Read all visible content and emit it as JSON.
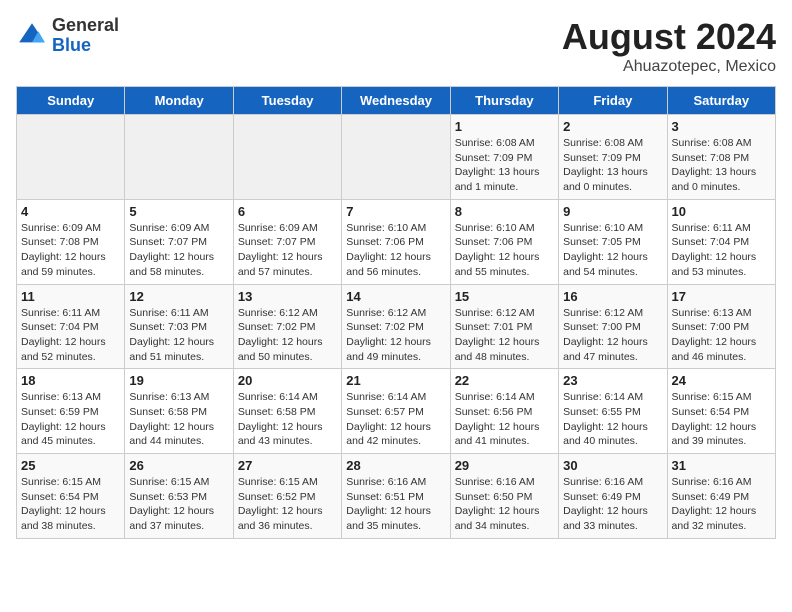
{
  "logo": {
    "general": "General",
    "blue": "Blue"
  },
  "title": "August 2024",
  "subtitle": "Ahuazotepec, Mexico",
  "days_of_week": [
    "Sunday",
    "Monday",
    "Tuesday",
    "Wednesday",
    "Thursday",
    "Friday",
    "Saturday"
  ],
  "weeks": [
    [
      {
        "day": "",
        "info": ""
      },
      {
        "day": "",
        "info": ""
      },
      {
        "day": "",
        "info": ""
      },
      {
        "day": "",
        "info": ""
      },
      {
        "day": "1",
        "info": "Sunrise: 6:08 AM\nSunset: 7:09 PM\nDaylight: 13 hours and 1 minute."
      },
      {
        "day": "2",
        "info": "Sunrise: 6:08 AM\nSunset: 7:09 PM\nDaylight: 13 hours and 0 minutes."
      },
      {
        "day": "3",
        "info": "Sunrise: 6:08 AM\nSunset: 7:08 PM\nDaylight: 13 hours and 0 minutes."
      }
    ],
    [
      {
        "day": "4",
        "info": "Sunrise: 6:09 AM\nSunset: 7:08 PM\nDaylight: 12 hours and 59 minutes."
      },
      {
        "day": "5",
        "info": "Sunrise: 6:09 AM\nSunset: 7:07 PM\nDaylight: 12 hours and 58 minutes."
      },
      {
        "day": "6",
        "info": "Sunrise: 6:09 AM\nSunset: 7:07 PM\nDaylight: 12 hours and 57 minutes."
      },
      {
        "day": "7",
        "info": "Sunrise: 6:10 AM\nSunset: 7:06 PM\nDaylight: 12 hours and 56 minutes."
      },
      {
        "day": "8",
        "info": "Sunrise: 6:10 AM\nSunset: 7:06 PM\nDaylight: 12 hours and 55 minutes."
      },
      {
        "day": "9",
        "info": "Sunrise: 6:10 AM\nSunset: 7:05 PM\nDaylight: 12 hours and 54 minutes."
      },
      {
        "day": "10",
        "info": "Sunrise: 6:11 AM\nSunset: 7:04 PM\nDaylight: 12 hours and 53 minutes."
      }
    ],
    [
      {
        "day": "11",
        "info": "Sunrise: 6:11 AM\nSunset: 7:04 PM\nDaylight: 12 hours and 52 minutes."
      },
      {
        "day": "12",
        "info": "Sunrise: 6:11 AM\nSunset: 7:03 PM\nDaylight: 12 hours and 51 minutes."
      },
      {
        "day": "13",
        "info": "Sunrise: 6:12 AM\nSunset: 7:02 PM\nDaylight: 12 hours and 50 minutes."
      },
      {
        "day": "14",
        "info": "Sunrise: 6:12 AM\nSunset: 7:02 PM\nDaylight: 12 hours and 49 minutes."
      },
      {
        "day": "15",
        "info": "Sunrise: 6:12 AM\nSunset: 7:01 PM\nDaylight: 12 hours and 48 minutes."
      },
      {
        "day": "16",
        "info": "Sunrise: 6:12 AM\nSunset: 7:00 PM\nDaylight: 12 hours and 47 minutes."
      },
      {
        "day": "17",
        "info": "Sunrise: 6:13 AM\nSunset: 7:00 PM\nDaylight: 12 hours and 46 minutes."
      }
    ],
    [
      {
        "day": "18",
        "info": "Sunrise: 6:13 AM\nSunset: 6:59 PM\nDaylight: 12 hours and 45 minutes."
      },
      {
        "day": "19",
        "info": "Sunrise: 6:13 AM\nSunset: 6:58 PM\nDaylight: 12 hours and 44 minutes."
      },
      {
        "day": "20",
        "info": "Sunrise: 6:14 AM\nSunset: 6:58 PM\nDaylight: 12 hours and 43 minutes."
      },
      {
        "day": "21",
        "info": "Sunrise: 6:14 AM\nSunset: 6:57 PM\nDaylight: 12 hours and 42 minutes."
      },
      {
        "day": "22",
        "info": "Sunrise: 6:14 AM\nSunset: 6:56 PM\nDaylight: 12 hours and 41 minutes."
      },
      {
        "day": "23",
        "info": "Sunrise: 6:14 AM\nSunset: 6:55 PM\nDaylight: 12 hours and 40 minutes."
      },
      {
        "day": "24",
        "info": "Sunrise: 6:15 AM\nSunset: 6:54 PM\nDaylight: 12 hours and 39 minutes."
      }
    ],
    [
      {
        "day": "25",
        "info": "Sunrise: 6:15 AM\nSunset: 6:54 PM\nDaylight: 12 hours and 38 minutes."
      },
      {
        "day": "26",
        "info": "Sunrise: 6:15 AM\nSunset: 6:53 PM\nDaylight: 12 hours and 37 minutes."
      },
      {
        "day": "27",
        "info": "Sunrise: 6:15 AM\nSunset: 6:52 PM\nDaylight: 12 hours and 36 minutes."
      },
      {
        "day": "28",
        "info": "Sunrise: 6:16 AM\nSunset: 6:51 PM\nDaylight: 12 hours and 35 minutes."
      },
      {
        "day": "29",
        "info": "Sunrise: 6:16 AM\nSunset: 6:50 PM\nDaylight: 12 hours and 34 minutes."
      },
      {
        "day": "30",
        "info": "Sunrise: 6:16 AM\nSunset: 6:49 PM\nDaylight: 12 hours and 33 minutes."
      },
      {
        "day": "31",
        "info": "Sunrise: 6:16 AM\nSunset: 6:49 PM\nDaylight: 12 hours and 32 minutes."
      }
    ]
  ]
}
